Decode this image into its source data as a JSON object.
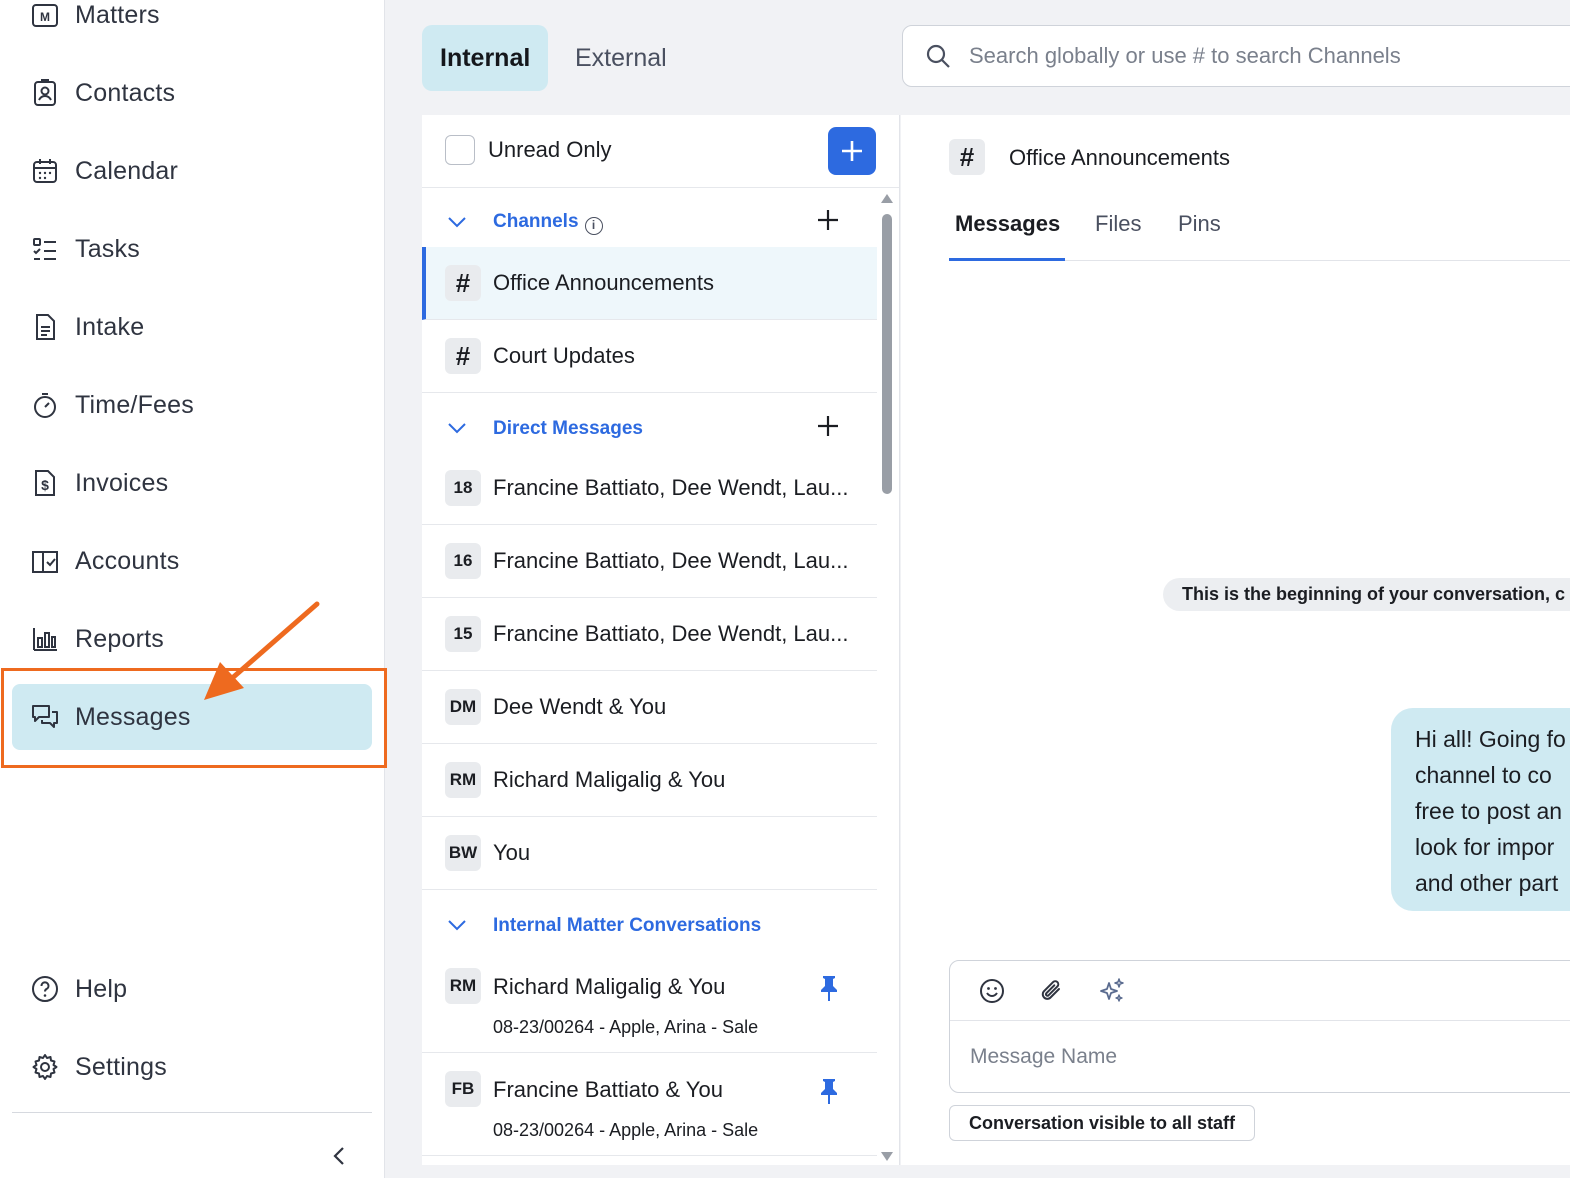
{
  "sidebar": {
    "items": [
      {
        "label": "Matters",
        "icon": "matters-icon"
      },
      {
        "label": "Contacts",
        "icon": "contacts-icon"
      },
      {
        "label": "Calendar",
        "icon": "calendar-icon"
      },
      {
        "label": "Tasks",
        "icon": "tasks-icon"
      },
      {
        "label": "Intake",
        "icon": "intake-icon"
      },
      {
        "label": "Time/Fees",
        "icon": "timer-icon"
      },
      {
        "label": "Invoices",
        "icon": "invoice-dollar-icon"
      },
      {
        "label": "Accounts",
        "icon": "book-check-icon"
      },
      {
        "label": "Reports",
        "icon": "bar-chart-icon"
      },
      {
        "label": "Messages",
        "icon": "chat-bubbles-icon",
        "active": true
      }
    ],
    "bottom": [
      {
        "label": "Help",
        "icon": "help-circle-icon"
      },
      {
        "label": "Settings",
        "icon": "gear-icon"
      }
    ],
    "annotation_color": "#ee6a1f"
  },
  "top_tabs": {
    "internal": "Internal",
    "external": "External"
  },
  "search": {
    "placeholder": "Search globally or use # to search Channels"
  },
  "list": {
    "unread_only": "Unread Only",
    "sections": {
      "channels": "Channels",
      "direct_messages": "Direct Messages",
      "internal_matter": "Internal Matter Conversations"
    },
    "channels": [
      {
        "badge": "#",
        "name": "Office Announcements",
        "active": true
      },
      {
        "badge": "#",
        "name": "Court Updates"
      }
    ],
    "direct_messages": [
      {
        "badge": "18",
        "name": "Francine Battiato, Dee Wendt, Lau..."
      },
      {
        "badge": "16",
        "name": "Francine Battiato, Dee Wendt, Lau..."
      },
      {
        "badge": "15",
        "name": "Francine Battiato, Dee Wendt, Lau..."
      },
      {
        "badge": "DM",
        "name": "Dee Wendt & You"
      },
      {
        "badge": "RM",
        "name": "Richard Maligalig & You"
      },
      {
        "badge": "BW",
        "name": "You"
      }
    ],
    "matter_conversations": [
      {
        "badge": "RM",
        "name": "Richard Maligalig & You",
        "matter": "08-23/00264 - Apple, Arina - Sale"
      },
      {
        "badge": "FB",
        "name": "Francine Battiato & You",
        "matter": "08-23/00264 - Apple, Arina - Sale"
      }
    ]
  },
  "conversation": {
    "hash": "#",
    "title": "Office Announcements",
    "tabs": [
      "Messages",
      "Files",
      "Pins"
    ],
    "beginning_text": "This is the beginning of your conversation, c",
    "bubble_text": "Hi all! Going fo\nchannel to co\nfree to post an\nlook for impor\nand other part",
    "composer_placeholder": "Message Name",
    "visibility": "Conversation visible to all staff"
  },
  "colors": {
    "accent": "#2d6ae0",
    "active_bg": "#cfeaf2"
  }
}
